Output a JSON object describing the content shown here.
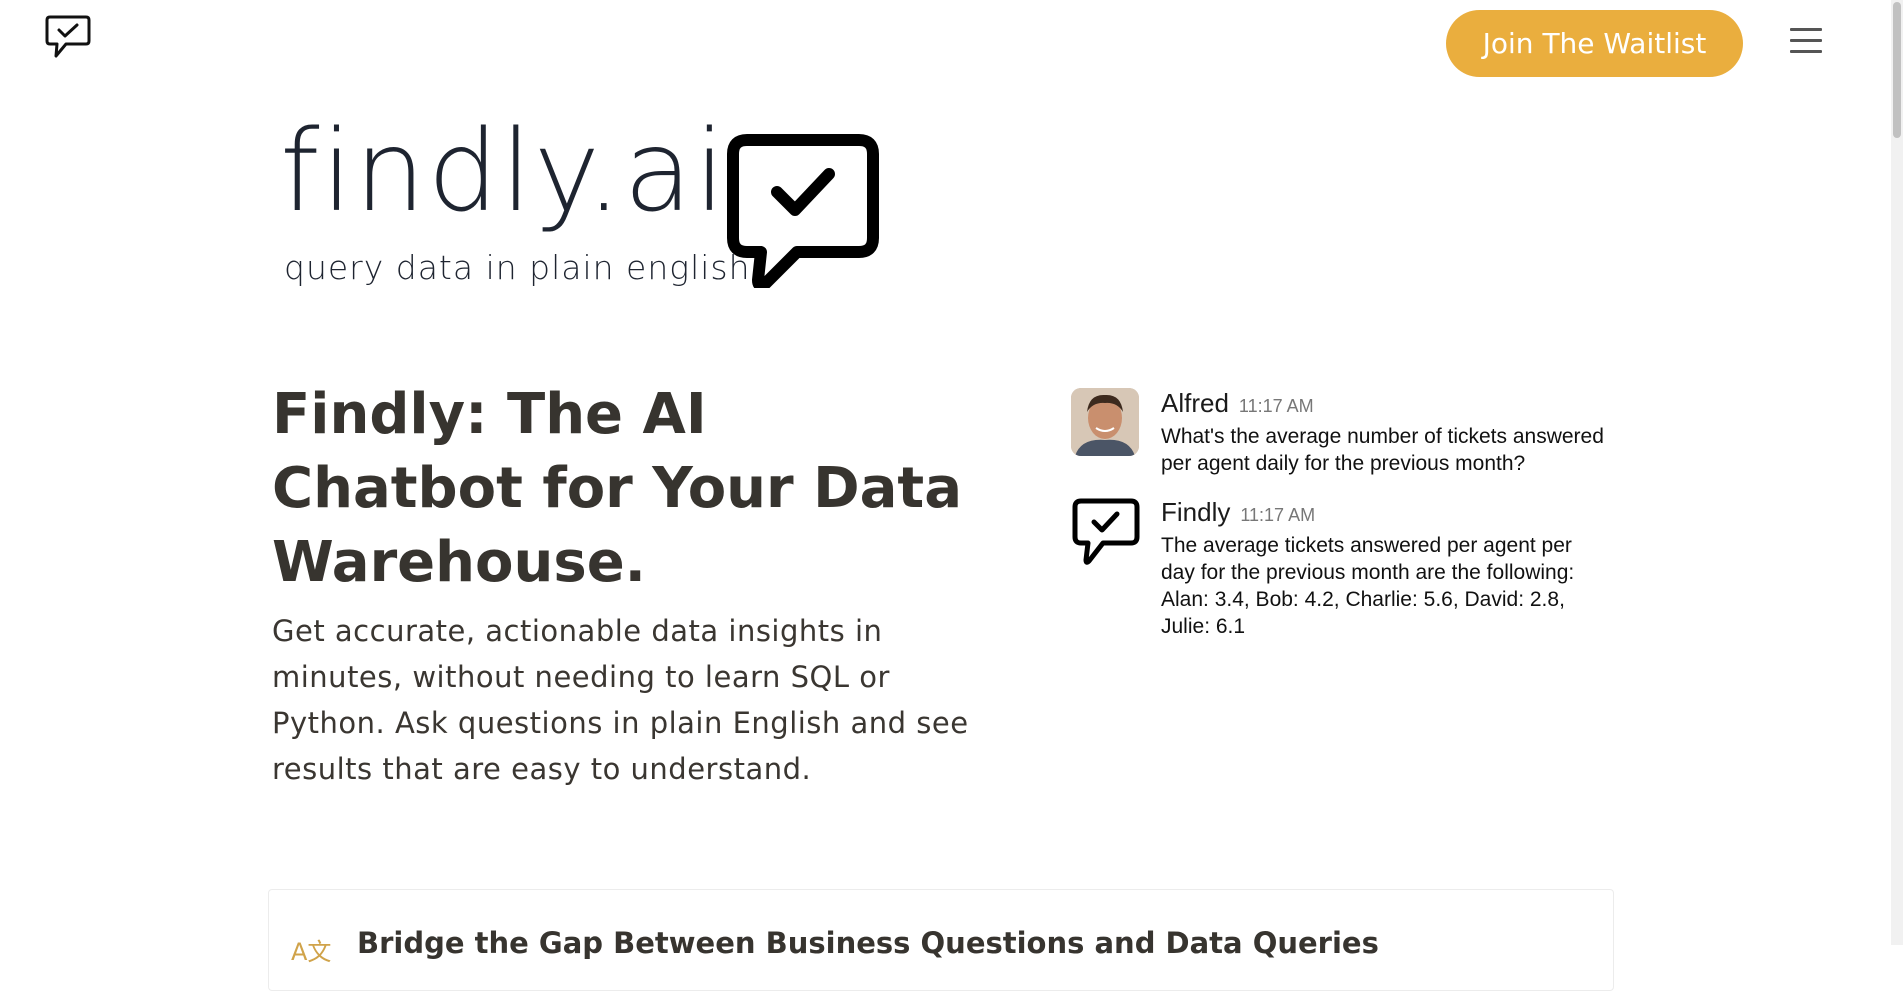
{
  "header": {
    "logo_icon": "chat-check-icon",
    "cta_label": "Join The Waitlist",
    "menu_icon": "hamburger-icon",
    "accent_color": "#eaae3e"
  },
  "brand": {
    "wordmark": "findly.ai",
    "tagline": "query data in plain english",
    "icon": "chat-check-icon"
  },
  "hero": {
    "title": "Findly: The AI Chatbot for Your Data Warehouse.",
    "description": "Get accurate, actionable data insights in minutes, without needing to learn SQL or Python. Ask questions in plain English and see results that are easy to understand."
  },
  "chat": {
    "messages": [
      {
        "name": "Alfred",
        "time": "11:17 AM",
        "text": "What's the average number of tickets answered per agent daily for the previous month?",
        "avatar": "user-photo"
      },
      {
        "name": "Findly",
        "time": "11:17 AM",
        "text": "The average tickets answered per agent per day for the previous month are the following: Alan: 3.4, Bob: 4.2, Charlie: 5.6, David: 2.8, Julie: 6.1",
        "avatar": "chat-check-icon"
      }
    ]
  },
  "feature": {
    "icon": "translate-icon",
    "icon_glyph": "A文",
    "title": "Bridge the Gap Between Business Questions and Data Queries"
  }
}
